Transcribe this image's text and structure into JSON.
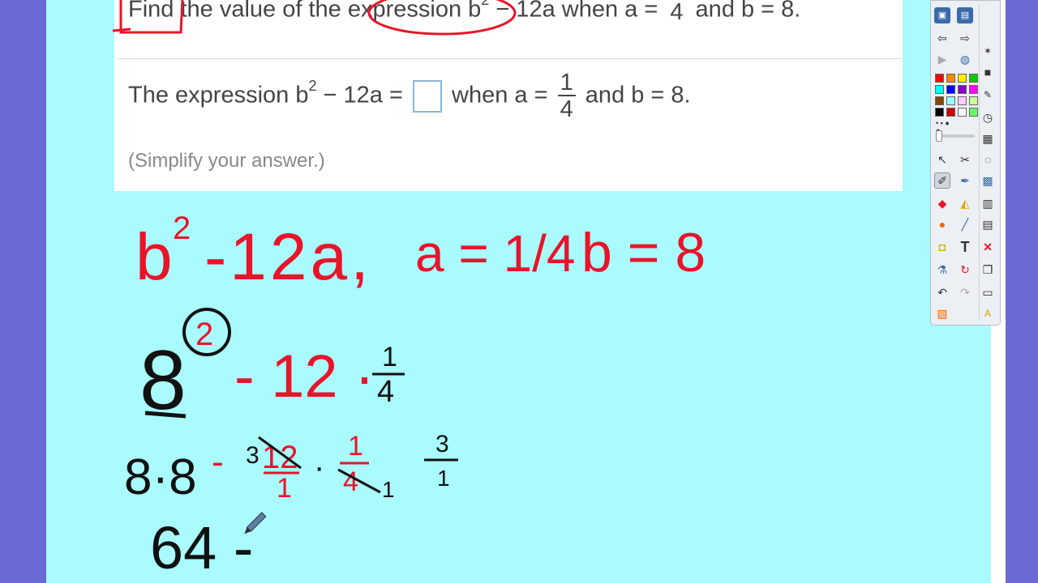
{
  "problem": {
    "question_prefix": "Find the value of the expression b",
    "question_exponent": "2",
    "question_middle": " − 12a when a = ",
    "question_frac_num": "",
    "question_frac_den": "4",
    "question_suffix": " and b = 8.",
    "answer_prefix": "The expression b",
    "answer_exponent": "2",
    "answer_middle": " − 12a = ",
    "answer_when": " when a = ",
    "answer_frac_num": "1",
    "answer_frac_den": "4",
    "answer_suffix": " and b = 8.",
    "hint": "(Simplify your answer.)"
  },
  "handwriting": {
    "line1_expr": "b",
    "line1_exp": "2",
    "line1_rest": "-12a,",
    "line1_a": "a = 1/4",
    "line1_b": "b = 8",
    "line2_base": "8",
    "line2_exp": "2",
    "line2_rest": "- 12 ·",
    "line2_frac_num": "1",
    "line2_frac_den": "4",
    "line3_left": "8·8",
    "line3_minus": "-",
    "line3_small3": "3",
    "line3_12": "12",
    "line3_one": "1",
    "line3_dot": "·",
    "line3_frac_num": "1",
    "line3_frac_den": "4",
    "line3_sub1": "1",
    "line3_side_num": "3",
    "line3_side_den": "1",
    "line4": "64 -"
  },
  "colors": {
    "canvas_bg": "#a9fbfd",
    "frame_bg": "#6a6ad6",
    "ink_red": "#e8142a",
    "ink_black": "#111111"
  },
  "toolbar": {
    "palette": [
      "#ff0000",
      "#ff8800",
      "#ffee00",
      "#00cc00",
      "#0000ff",
      "#8800cc",
      "#ff00ff",
      "#00ffff",
      "#884400",
      "#ff6666",
      "#ffcc99",
      "#ccff99",
      "#99ffff",
      "#ff99ff",
      "#000000",
      "#cc0000",
      "#ffffff",
      "#cccccc",
      "#999999",
      "#66ff66"
    ]
  }
}
